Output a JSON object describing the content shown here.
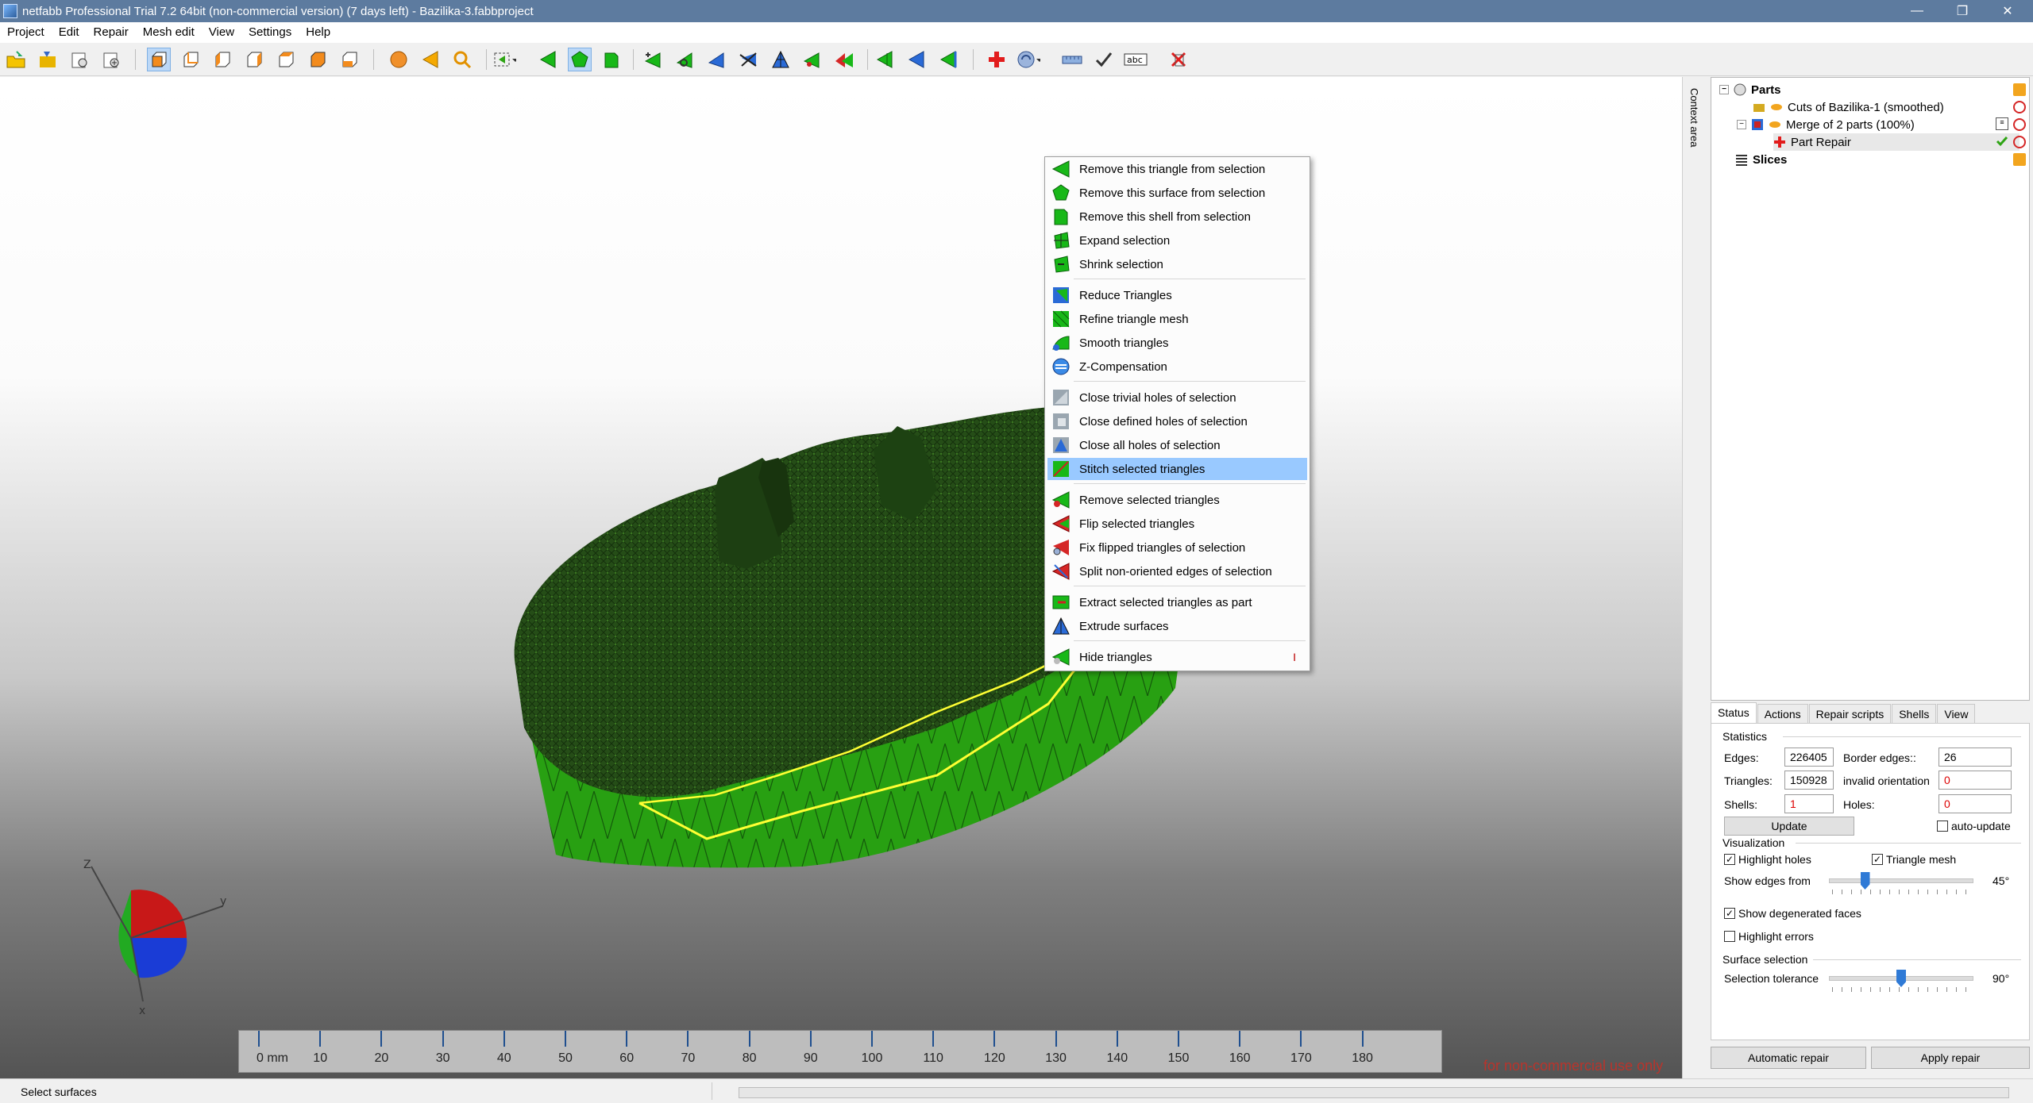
{
  "window": {
    "title": "netfabb Professional Trial 7.2 64bit (non-commercial version) (7 days left) - Bazilika-3.fabbproject",
    "controls": [
      "—",
      "❐",
      "✕"
    ]
  },
  "menubar": [
    "Project",
    "Edit",
    "Repair",
    "Mesh edit",
    "View",
    "Settings",
    "Help"
  ],
  "toolbar": {
    "icons": [
      "open-project-icon",
      "add-part-icon",
      "new-project-icon",
      "add-slice-icon",
      "view-front-icon",
      "view-back-icon",
      "view-left-icon",
      "view-right-icon",
      "view-top-icon",
      "view-bottom-icon",
      "sphere-view-icon",
      "triangle-select-icon",
      "zoom-icon",
      "select-box-icon",
      "select-triangle-icon",
      "select-surface-icon",
      "select-shell-icon",
      "add-triangle-icon",
      "vertex-tool-icon",
      "split-icon",
      "cut-icon",
      "measure-icon",
      "extrude-icon",
      "flip-icon",
      "move-left-icon",
      "move-back-icon",
      "move-right-icon",
      "add-repair-icon",
      "rotate-view-icon",
      "ruler-icon",
      "check-icon",
      "label-icon",
      "remove-repair-icon"
    ]
  },
  "context_menu": {
    "groups": [
      [
        {
          "label": "Remove this triangle from selection",
          "icon": "triangle-icon"
        },
        {
          "label": "Remove this surface from selection",
          "icon": "pentagon-icon"
        },
        {
          "label": "Remove this shell from selection",
          "icon": "shell-icon"
        },
        {
          "label": "Expand selection",
          "icon": "expand-icon"
        },
        {
          "label": "Shrink selection",
          "icon": "shrink-icon"
        }
      ],
      [
        {
          "label": "Reduce Triangles",
          "icon": "reduce-icon"
        },
        {
          "label": "Refine triangle mesh",
          "icon": "refine-icon"
        },
        {
          "label": "Smooth triangles",
          "icon": "smooth-icon"
        },
        {
          "label": "Z-Compensation",
          "icon": "z-compensation-icon"
        }
      ],
      [
        {
          "label": "Close trivial holes of selection",
          "icon": "close-trivial-holes-icon"
        },
        {
          "label": "Close defined holes of selection",
          "icon": "close-defined-holes-icon"
        },
        {
          "label": "Close all holes of selection",
          "icon": "close-all-holes-icon"
        },
        {
          "label": "Stitch selected triangles",
          "icon": "stitch-icon",
          "highlighted": true
        }
      ],
      [
        {
          "label": "Remove selected triangles",
          "icon": "remove-triangles-icon"
        },
        {
          "label": "Flip selected triangles",
          "icon": "flip-triangles-icon"
        },
        {
          "label": "Fix flipped triangles of selection",
          "icon": "fix-flipped-icon"
        },
        {
          "label": "Split non-oriented edges of selection",
          "icon": "split-edges-icon"
        }
      ],
      [
        {
          "label": "Extract selected triangles as part",
          "icon": "extract-icon"
        },
        {
          "label": "Extrude surfaces",
          "icon": "extrude-surfaces-icon"
        }
      ],
      [
        {
          "label": "Hide triangles",
          "icon": "hide-triangles-icon",
          "shortcut": "I"
        }
      ]
    ]
  },
  "ruler": {
    "unit_label": "0 mm",
    "ticks": [
      "10",
      "20",
      "30",
      "40",
      "50",
      "60",
      "70",
      "80",
      "90",
      "100",
      "110",
      "120",
      "130",
      "140",
      "150",
      "160",
      "170",
      "180"
    ]
  },
  "watermark": "for non-commercial use only",
  "side_tab": "Context area",
  "tree": {
    "items": [
      {
        "label": "Parts",
        "bold": true
      },
      {
        "label": "Cuts of Bazilika-1 (smoothed)"
      },
      {
        "label": "Merge of 2 parts (100%)"
      },
      {
        "label": "Part Repair"
      },
      {
        "label": "Slices",
        "bold": true
      }
    ]
  },
  "tabs": [
    "Status",
    "Actions",
    "Repair scripts",
    "Shells",
    "View"
  ],
  "status": {
    "statistics_title": "Statistics",
    "edges_label": "Edges:",
    "edges": "226405",
    "triangles_label": "Triangles:",
    "triangles": "150928",
    "shells_label": "Shells:",
    "shells": "1",
    "border_edges_label": "Border edges::",
    "border_edges": "26",
    "invalid_orientation_label": "invalid orientation",
    "invalid_orientation": "0",
    "holes_label": "Holes:",
    "holes": "0",
    "update_label": "Update",
    "auto_update_label": "auto-update",
    "auto_update_checked": false,
    "visualization_title": "Visualization",
    "highlight_holes_label": "Highlight holes",
    "highlight_holes_checked": true,
    "triangle_mesh_label": "Triangle mesh",
    "triangle_mesh_checked": true,
    "show_edges_label": "Show edges from",
    "show_edges_value": "45°",
    "show_edges_fraction": 0.25,
    "show_degenerated_label": "Show degenerated faces",
    "show_degenerated_checked": true,
    "highlight_errors_label": "Highlight errors",
    "highlight_errors_checked": false,
    "surface_selection_title": "Surface selection",
    "selection_tolerance_label": "Selection tolerance",
    "selection_tolerance_value": "90°",
    "selection_tolerance_fraction": 0.5
  },
  "buttons": {
    "automatic_repair": "Automatic repair",
    "apply_repair": "Apply repair"
  },
  "statusbar": {
    "text": "Select surfaces"
  },
  "colors": {
    "titlebar": "#5d7b9f",
    "mesh_dark": "#1f4a12",
    "mesh_green": "#2ea414",
    "highlight": "#99c9ff",
    "selection_edge": "#ffff33"
  }
}
